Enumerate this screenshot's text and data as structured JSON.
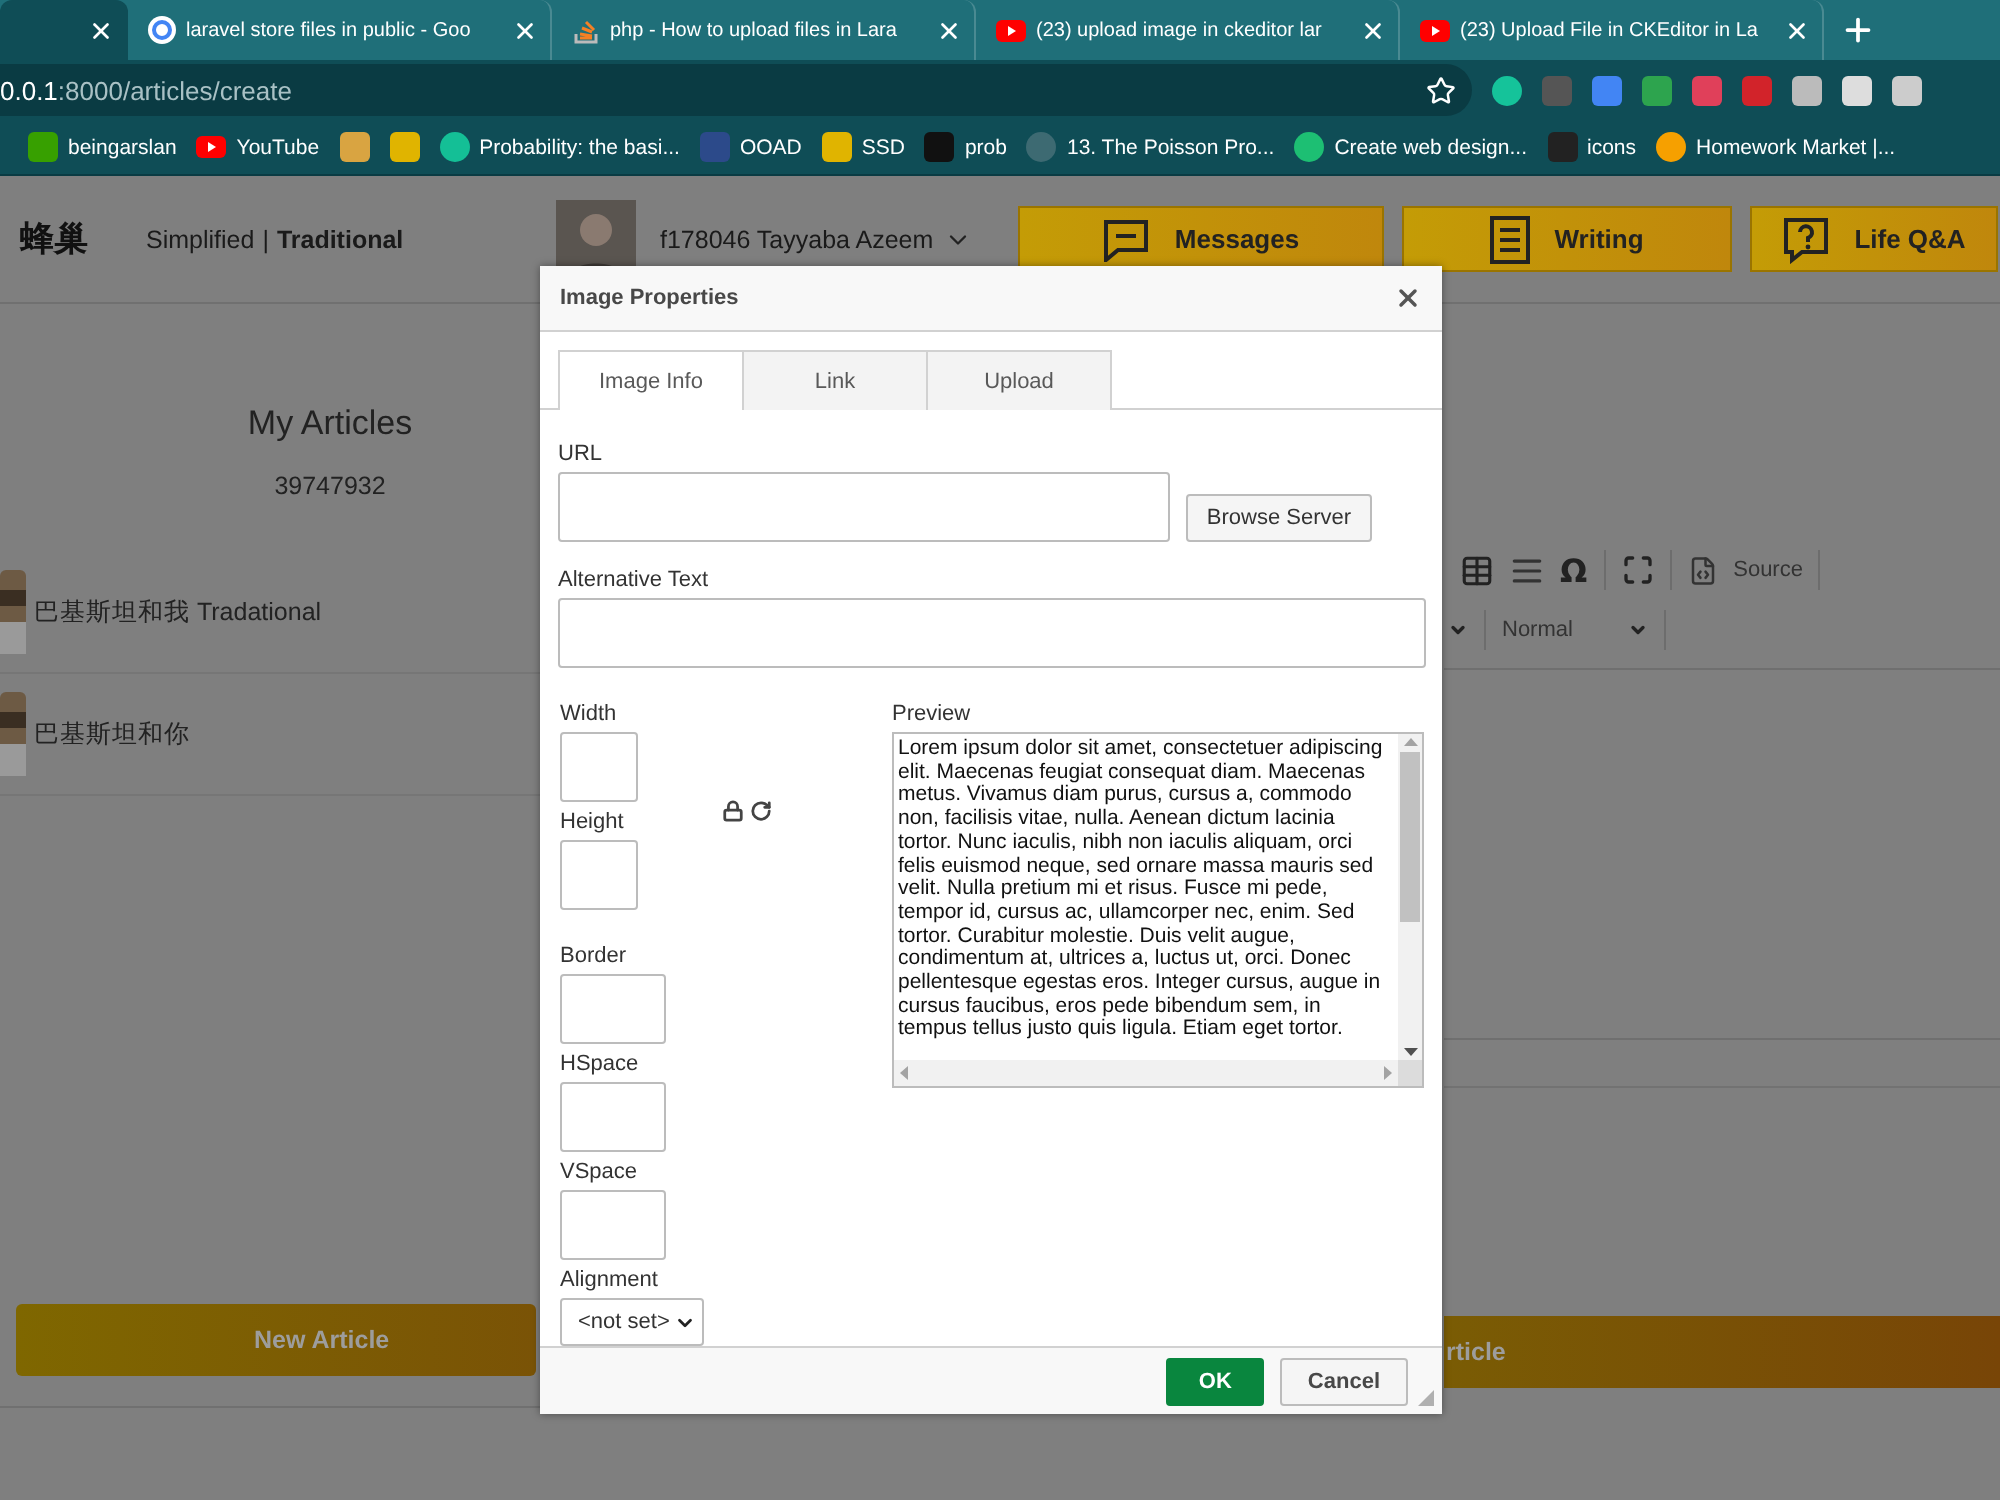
{
  "browser": {
    "tabs": [
      {
        "kind": "blank",
        "selected": true
      },
      {
        "title": "laravel store files in public - Goo",
        "kind": "google",
        "selected": false
      },
      {
        "title": "php - How to upload files in Lara",
        "kind": "stack",
        "selected": false
      },
      {
        "title": "(23) upload image in ckeditor lar",
        "kind": "youtube",
        "selected": false
      },
      {
        "title": "(23) Upload File in CKEditor in La",
        "kind": "youtube",
        "selected": false
      }
    ],
    "address": {
      "host": "0.0.1",
      "path": ":8000/articles/create"
    },
    "bookmarks": [
      {
        "label": "beingarslan",
        "kind": "upwork"
      },
      {
        "label": "YouTube",
        "kind": "youtube"
      },
      {
        "kind": "person"
      },
      {
        "kind": "figure"
      },
      {
        "label": "Probability: the basi...",
        "kind": "khan"
      },
      {
        "label": "OOAD",
        "kind": "grid"
      },
      {
        "label": "SSD",
        "kind": "figure"
      },
      {
        "label": "prob",
        "kind": "s"
      },
      {
        "label": "13. The Poisson Pro...",
        "kind": "ring"
      },
      {
        "label": "Create web design...",
        "kind": "fiverr"
      },
      {
        "label": "icons",
        "kind": "eye"
      },
      {
        "label": "Homework Market |...",
        "kind": "lifebuoy"
      }
    ]
  },
  "header": {
    "logo": "蜂巢",
    "languages": [
      {
        "label": "Simplified",
        "selected": false
      },
      {
        "label": "Traditional",
        "selected": true
      }
    ],
    "language_divider": "|",
    "user": "f178046 Tayyaba Azeem",
    "nav": [
      {
        "label": "Messages",
        "kind": "message"
      },
      {
        "label": "Writing",
        "kind": "list"
      },
      {
        "label": "Life Q&A",
        "kind": "question"
      }
    ]
  },
  "articles": {
    "title": "My Articles",
    "count": "39747932",
    "items": [
      {
        "title": "巴基斯坦和我 Tradational"
      },
      {
        "title": "巴基斯坦和你"
      }
    ],
    "new_button": "New Article"
  },
  "editor": {
    "toolbar": [
      {
        "kind": "table"
      },
      {
        "kind": "rule"
      },
      {
        "kind": "glyph",
        "label": "Ω"
      },
      {
        "kind": "separator"
      },
      {
        "kind": "maximize"
      },
      {
        "kind": "separator"
      },
      {
        "kind": "source",
        "label": "Source"
      },
      {
        "kind": "separator"
      }
    ],
    "format": "Normal",
    "submit": "rticle"
  },
  "dialog": {
    "title": "Image Properties",
    "tabs": [
      {
        "label": "Image Info",
        "selected": true
      },
      {
        "label": "Link",
        "selected": false
      },
      {
        "label": "Upload",
        "selected": false
      }
    ],
    "url_label": "URL",
    "browse": "Browse Server",
    "alt_label": "Alternative Text",
    "sizes": [
      {
        "label": "Width",
        "kind": "narrow"
      },
      {
        "label": "Height",
        "kind": "narrow"
      }
    ],
    "spacing": [
      {
        "label": "Border",
        "kind": "wide"
      },
      {
        "label": "HSpace",
        "kind": "wide"
      },
      {
        "label": "VSpace",
        "kind": "wide"
      }
    ],
    "alignment": {
      "label": "Alignment",
      "value": "<not set>"
    },
    "preview": {
      "label": "Preview",
      "text": "Lorem ipsum dolor sit amet, consectetuer adipiscing elit. Maecenas feugiat consequat diam. Maecenas metus. Vivamus diam purus, cursus a, commodo non, facilisis vitae, nulla. Aenean dictum lacinia tortor. Nunc iaculis, nibh non iaculis aliquam, orci felis euismod neque, sed ornare massa mauris sed velit. Nulla pretium mi et risus. Fusce mi pede, tempor id, cursus ac, ullamcorper nec, enim. Sed tortor. Curabitur molestie. Duis velit augue, condimentum at, ultrices a, luctus ut, orci. Donec pellentesque egestas eros. Integer cursus, augue in cursus faucibus, eros pede bibendum sem, in tempus tellus justo quis ligula. Etiam eget tortor."
    },
    "buttons": [
      {
        "label": "OK",
        "kind": "primary"
      },
      {
        "label": "Cancel",
        "kind": "secondary"
      }
    ]
  }
}
